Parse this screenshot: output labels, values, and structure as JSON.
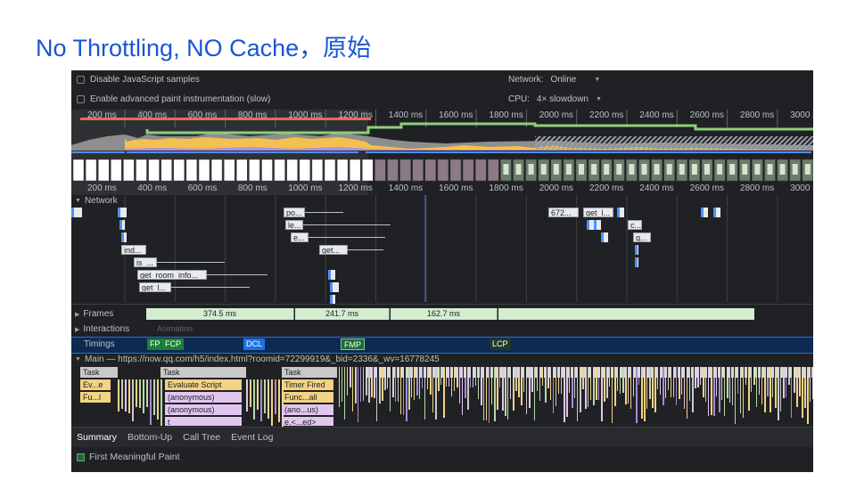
{
  "slide": {
    "title": "No Throttling, NO Cache，原始"
  },
  "options": {
    "disable_js_samples": "Disable JavaScript samples",
    "advanced_paint": "Enable advanced paint instrumentation (slow)"
  },
  "settings": {
    "network_label": "Network:",
    "network_value": "Online",
    "cpu_label": "CPU:",
    "cpu_value": "4× slowdown"
  },
  "ruler_ticks": [
    "200 ms",
    "400 ms",
    "600 ms",
    "800 ms",
    "1000 ms",
    "1200 ms",
    "1400 ms",
    "1600 ms",
    "1800 ms",
    "2000 ms",
    "2200 ms",
    "2400 ms",
    "2600 ms",
    "2800 ms",
    "3000 ms"
  ],
  "tracks": {
    "network": "Network",
    "frames": "Frames",
    "interactions": "Interactions",
    "timings": "Timings",
    "main": "Main — https://now.qq.com/h5/index.html?roomid=72299919&_bid=2336&_wv=16778245",
    "animation": "Animation"
  },
  "network_requests": [
    "po...",
    "le...",
    "e...",
    "get...",
    "672...",
    "get_l...",
    "c...",
    "g...",
    "ind...",
    "is_...",
    "get_room_info...",
    "get_l..."
  ],
  "frames": [
    "374.5 ms",
    "241.7 ms",
    "162.7 ms"
  ],
  "timings": {
    "fp": "FP",
    "fcp": "FCP",
    "dcl": "DCL",
    "fmp": "FMP",
    "lcp": "LCP"
  },
  "flame": {
    "task1": "Task",
    "task2": "Task",
    "task3": "Task",
    "ev": "Ev...e",
    "fu": "Fu...l",
    "evaluate_script": "Evaluate Script",
    "anon1": "(anonymous)",
    "anon2": "(anonymous)",
    "t": "t",
    "timer_fired": "Timer Fired",
    "func_all": "Func...all",
    "ano_us": "(ano...us)",
    "e_ed": "e.<...ed>"
  },
  "bottom_tabs": [
    "Summary",
    "Bottom-Up",
    "Call Tree",
    "Event Log"
  ],
  "summary": {
    "item": "First Meaningful Paint"
  },
  "colors": {
    "title_blue": "#1a55d6",
    "panel_bg": "#202124",
    "scripting": "#f2c14e",
    "rendering": "#b38de8",
    "painting": "#7cc37a",
    "frames_green": "#d4ecd0",
    "dcl_blue": "#1a73e8",
    "fp_green": "#188038",
    "lcp_dark": "#1e3a2a",
    "task_gray": "#c9c9c9",
    "function_yellow": "#f3d384",
    "anon_lilac": "#e1c7ef"
  }
}
